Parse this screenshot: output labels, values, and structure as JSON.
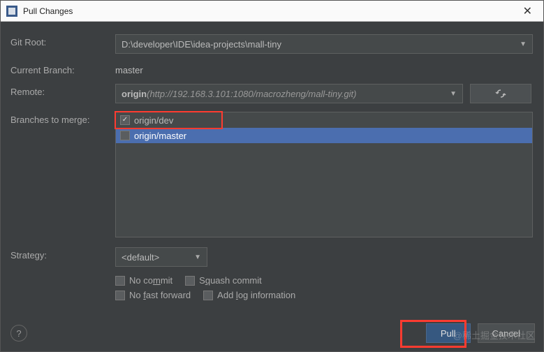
{
  "titlebar": {
    "title": "Pull Changes"
  },
  "labels": {
    "git_root": "Git Root:",
    "current_branch": "Current Branch:",
    "remote": "Remote:",
    "branches_to_merge": "Branches to merge:",
    "strategy": "Strategy:"
  },
  "values": {
    "git_root": "D:\\developer\\IDE\\idea-projects\\mall-tiny",
    "current_branch": "master",
    "remote_name": "origin",
    "remote_url": "(http://192.168.3.101:1080/macrozheng/mall-tiny.git)",
    "strategy": "<default>"
  },
  "branches": [
    {
      "name": "origin/dev",
      "checked": true,
      "selected": false,
      "highlighted": true
    },
    {
      "name": "origin/master",
      "checked": false,
      "selected": true,
      "highlighted": false
    }
  ],
  "checkboxes": {
    "no_commit_pre": "No co",
    "no_commit_u": "m",
    "no_commit_post": "mit",
    "squash_pre": "S",
    "squash_u": "q",
    "squash_post": "uash commit",
    "no_ff_pre": "No ",
    "no_ff_u": "f",
    "no_ff_post": "ast forward",
    "addlog_pre": "Add ",
    "addlog_u": "l",
    "addlog_post": "og information"
  },
  "buttons": {
    "pull": "Pull",
    "cancel": "Cancel",
    "help": "?"
  },
  "watermark": "@稀土掘金技术社区"
}
